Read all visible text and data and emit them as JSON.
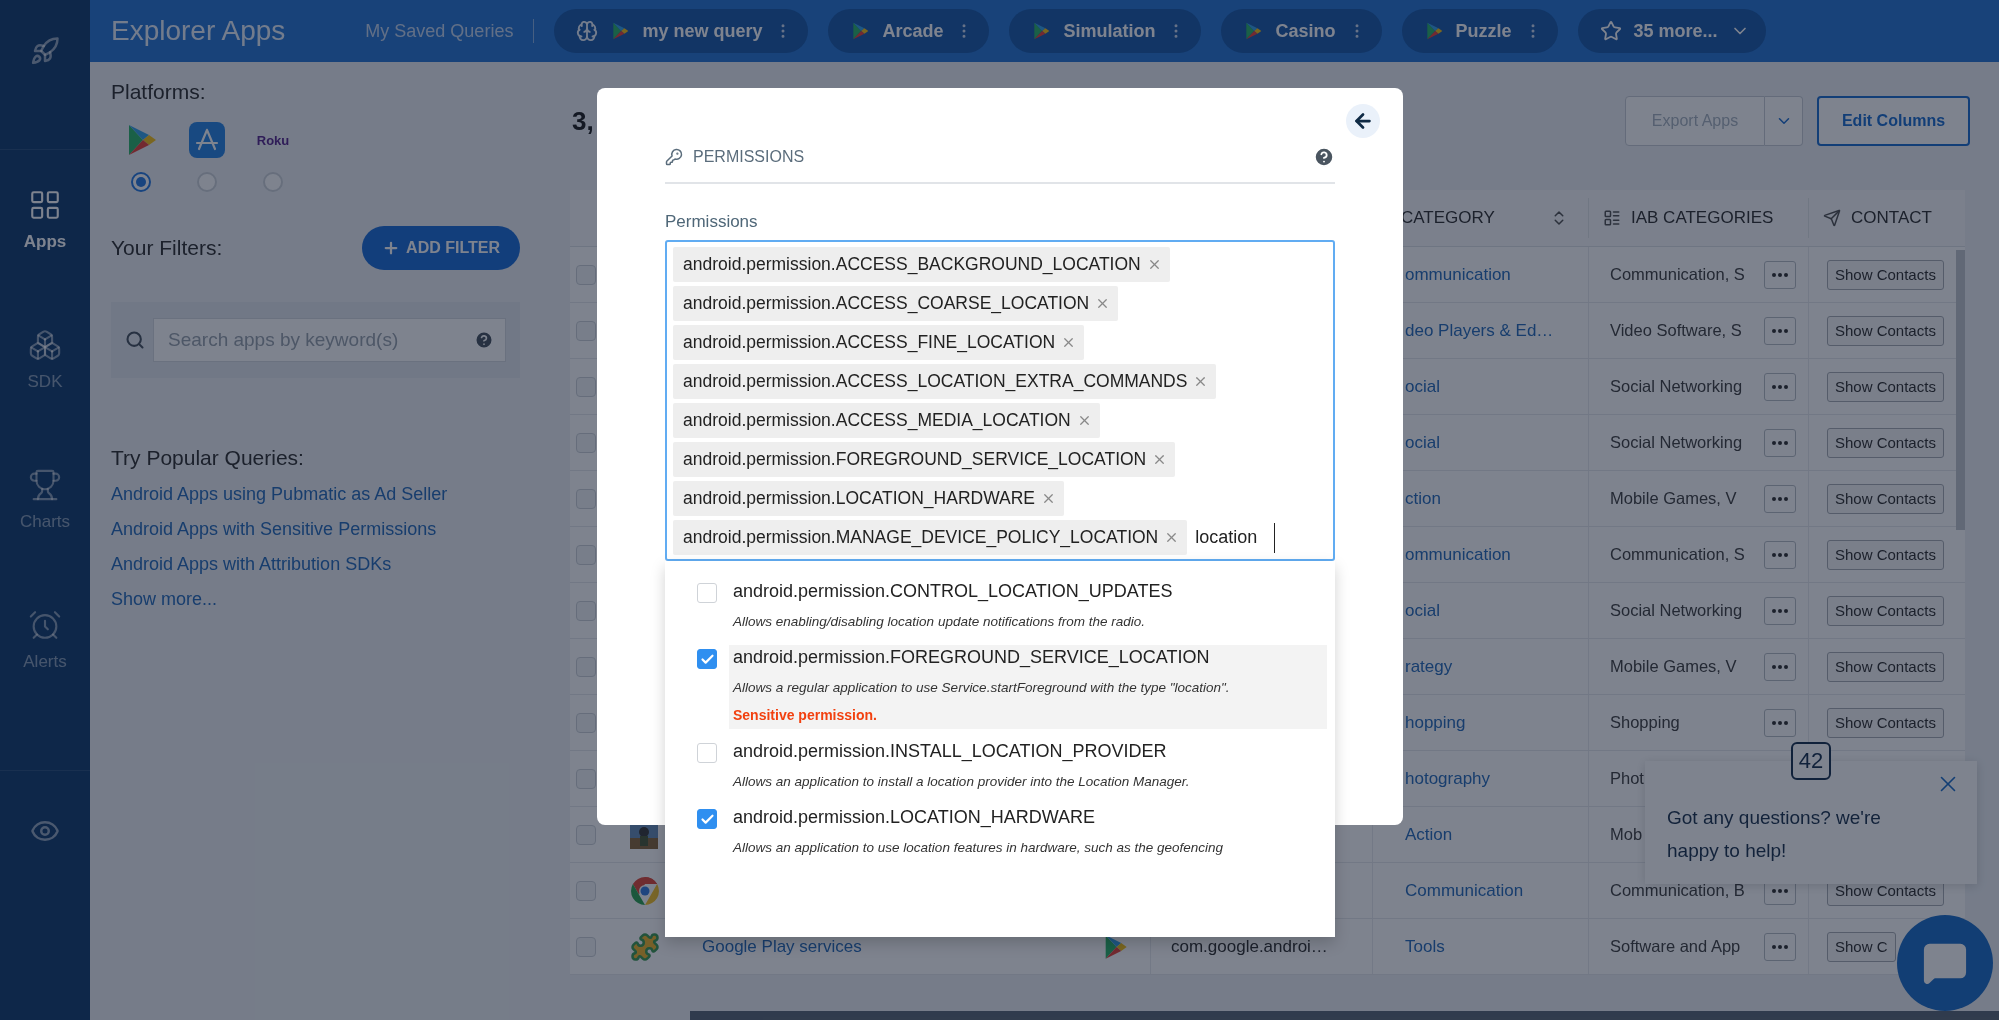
{
  "nav": {
    "items": [
      {
        "kind": "apps",
        "label": "Apps",
        "selected": true
      },
      {
        "kind": "sdk",
        "label": "SDK",
        "selected": false
      },
      {
        "kind": "charts",
        "label": "Charts",
        "selected": false
      },
      {
        "kind": "alerts",
        "label": "Alerts",
        "selected": false
      }
    ]
  },
  "top_bar": {
    "title": "Explorer Apps",
    "saved_label": "My Saved Queries",
    "queries": [
      {
        "kind": "custom",
        "label": "my new query"
      },
      {
        "kind": "play",
        "label": "Arcade"
      },
      {
        "kind": "play",
        "label": "Simulation"
      },
      {
        "kind": "play",
        "label": "Casino"
      },
      {
        "kind": "play",
        "label": "Puzzle"
      }
    ],
    "more": "35 more..."
  },
  "sidebar": {
    "platforms_title": "Platforms:",
    "platforms": [
      {
        "kind": "play",
        "selected": true
      },
      {
        "kind": "appstore",
        "selected": false
      },
      {
        "kind": "roku",
        "label": "Roku",
        "selected": false
      }
    ],
    "filters_title": "Your Filters:",
    "add_filter": "ADD FILTER",
    "search": {
      "placeholder": "Search apps by keyword(s)"
    },
    "popular_title": "Try Popular Queries:",
    "popular": [
      "Android Apps using Pubmatic as Ad Seller",
      "Android Apps with Sensitive Permissions",
      "Android Apps with Attribution SDKs"
    ],
    "show_more": "Show more..."
  },
  "results": {
    "count": "3,",
    "export": {
      "label": "Export Apps",
      "disabled": true
    },
    "edit_columns": "Edit Columns"
  },
  "table": {
    "columns": [
      {
        "kind": "sort",
        "label": "CATEGORY"
      },
      {
        "kind": "list",
        "label": "IAB CATEGORIES"
      },
      {
        "kind": "send",
        "label": "CONTACT"
      }
    ],
    "rows": [
      {
        "checked": false,
        "category": "ommunication",
        "iab": "Communication, S",
        "more": true,
        "contact": "Show Contacts"
      },
      {
        "checked": false,
        "category": "deo Players & Ed…",
        "iab": "Video Software, S",
        "more": true,
        "contact": "Show Contacts"
      },
      {
        "checked": false,
        "category": "ocial",
        "iab": "Social Networking",
        "more": true,
        "contact": "Show Contacts"
      },
      {
        "checked": false,
        "category": "ocial",
        "iab": "Social Networking",
        "more": true,
        "contact": "Show Contacts"
      },
      {
        "checked": false,
        "category": "ction",
        "iab": "Mobile Games, V",
        "more": true,
        "contact": "Show Contacts"
      },
      {
        "checked": false,
        "category": "ommunication",
        "iab": "Communication, S",
        "more": true,
        "contact": "Show Contacts"
      },
      {
        "checked": false,
        "category": "ocial",
        "iab": "Social Networking",
        "more": true,
        "contact": "Show Contacts"
      },
      {
        "checked": false,
        "category": "rategy",
        "iab": "Mobile Games, V",
        "more": true,
        "contact": "Show Contacts"
      },
      {
        "checked": false,
        "category": "hopping",
        "iab": "Shopping",
        "more": true,
        "contact": "Show Contacts"
      },
      {
        "checked": false,
        "category": "hotography",
        "iab": "Phot",
        "more": false
      },
      {
        "checked": false,
        "app": {
          "kind": "game"
        },
        "category": "Action",
        "iab": "Mob",
        "more": false
      },
      {
        "checked": false,
        "app": {
          "kind": "browser"
        },
        "category": "Communication",
        "iab": "Communication, B",
        "more": true,
        "contact": "Show Contacts"
      },
      {
        "checked": false,
        "app": {
          "kind": "puzzle"
        },
        "name": "Google Play services",
        "platform": {
          "kind": "play"
        },
        "package": "com.google.androi…",
        "category": "Tools",
        "iab": "Software and App",
        "more": true,
        "contact": "Show C"
      }
    ]
  },
  "modal": {
    "title": "PERMISSIONS",
    "field_label": "Permissions",
    "tags": [
      "android.permission.ACCESS_BACKGROUND_LOCATION",
      "android.permission.ACCESS_COARSE_LOCATION",
      "android.permission.ACCESS_FINE_LOCATION",
      "android.permission.ACCESS_LOCATION_EXTRA_COMMANDS",
      "android.permission.ACCESS_MEDIA_LOCATION",
      "android.permission.FOREGROUND_SERVICE_LOCATION",
      "android.permission.LOCATION_HARDWARE",
      "android.permission.MANAGE_DEVICE_POLICY_LOCATION"
    ],
    "query": "location",
    "options": [
      {
        "name": "android.permission.CONTROL_LOCATION_UPDATES",
        "description": "Allows enabling/disabling location update notifications from the radio.",
        "checked": false,
        "highlighted": false
      },
      {
        "name": "android.permission.FOREGROUND_SERVICE_LOCATION",
        "description": "Allows a regular application to use Service.startForeground with the type \"location\".",
        "note": "Sensitive permission.",
        "checked": true,
        "highlighted": true
      },
      {
        "name": "android.permission.INSTALL_LOCATION_PROVIDER",
        "description": "Allows an application to install a location provider into the Location Manager.",
        "checked": false,
        "highlighted": false
      },
      {
        "name": "android.permission.LOCATION_HARDWARE",
        "description": "Allows an application to use location features in hardware, such as the geofencing",
        "checked": true,
        "highlighted": false
      }
    ]
  },
  "chat": {
    "badge": "42",
    "message": "Got any questions? we're happy to help!"
  }
}
